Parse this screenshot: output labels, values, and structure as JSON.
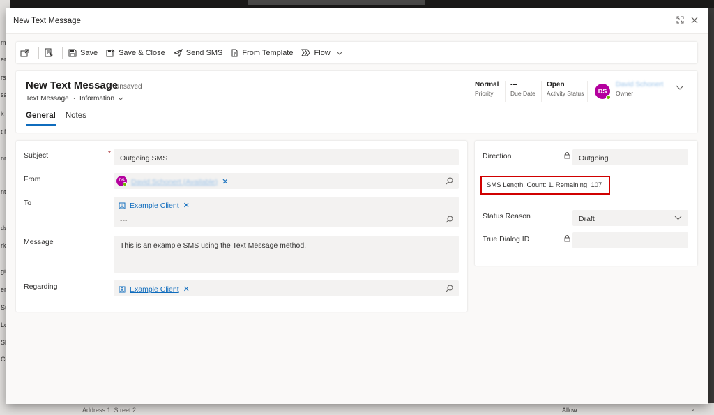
{
  "background": {
    "left_fragments": [
      "me",
      "er",
      "rs",
      "sag",
      "k T",
      "t M",
      "nn",
      "nta",
      "ds",
      "rke",
      "gin",
      "ers",
      "Su",
      "Lo",
      "Sh",
      "Co"
    ],
    "bottom_left_text": "Address 1: Street 2",
    "bottom_right_text": "Allow"
  },
  "dialog": {
    "title": "New Text Message"
  },
  "commandbar": {
    "save": "Save",
    "save_close": "Save & Close",
    "send_sms": "Send SMS",
    "from_template": "From Template",
    "flow": "Flow"
  },
  "record": {
    "title": "New Text Message",
    "unsaved": "- Unsaved",
    "entity": "Text Message",
    "form": "Information",
    "tabs": [
      "General",
      "Notes"
    ],
    "header_fields": {
      "priority": {
        "value": "Normal",
        "label": "Priority"
      },
      "due_date": {
        "value": "---",
        "label": "Due Date"
      },
      "activity_status": {
        "value": "Open",
        "label": "Activity Status"
      },
      "owner": {
        "initials": "DS",
        "name": "David Schonert",
        "label": "Owner"
      }
    }
  },
  "form": {
    "subject": {
      "label": "Subject",
      "value": "Outgoing SMS"
    },
    "from": {
      "label": "From",
      "initials": "DS",
      "value": "David Schonert (Available)"
    },
    "to": {
      "label": "To",
      "value": "Example Client",
      "empty": "---"
    },
    "message": {
      "label": "Message",
      "value": "This is an example SMS using the Text Message method."
    },
    "regarding": {
      "label": "Regarding",
      "value": "Example Client"
    }
  },
  "side": {
    "direction": {
      "label": "Direction",
      "value": "Outgoing"
    },
    "sms_length": "SMS Length. Count: 1. Remaining: 107",
    "status_reason": {
      "label": "Status Reason",
      "value": "Draft"
    },
    "true_dialog_id": {
      "label": "True Dialog ID",
      "value": ""
    }
  },
  "colors": {
    "accent": "#0f6cbd",
    "avatar": "#b4009e",
    "presence": "#6bb700",
    "highlight_border": "#d00000"
  }
}
